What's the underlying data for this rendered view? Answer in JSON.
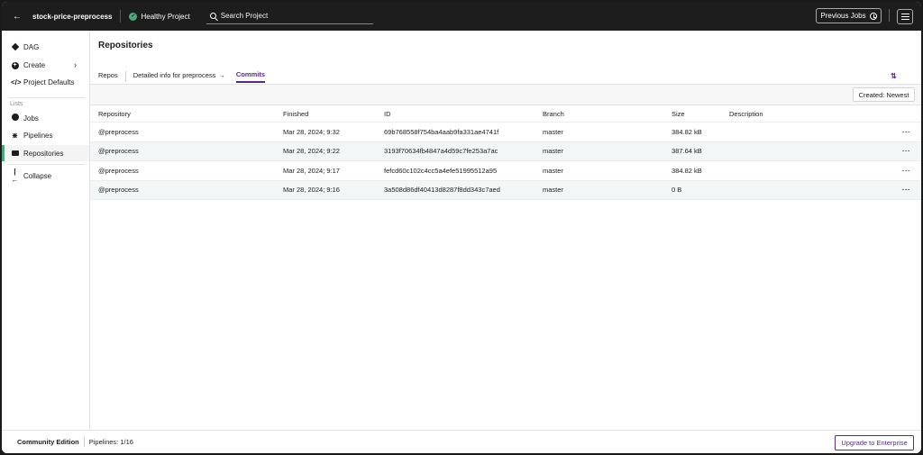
{
  "topbar": {
    "back_icon": "arrow-left",
    "project_name": "stock-price-preprocess",
    "health_label": "Healthy Project",
    "search_placeholder": "Search Project",
    "previous_jobs_label": "Previous Jobs"
  },
  "sidebar": {
    "items": [
      {
        "label": "DAG",
        "icon": "diamond-icon"
      },
      {
        "label": "Create",
        "icon": "plus-circle-icon"
      },
      {
        "label": "Project Defaults",
        "icon": "code-icon"
      }
    ],
    "lists_label": "Lists",
    "list_items": [
      {
        "label": "Jobs",
        "icon": "jobs-icon"
      },
      {
        "label": "Pipelines",
        "icon": "pipelines-icon"
      },
      {
        "label": "Repositories",
        "icon": "folder-icon"
      }
    ],
    "collapse_label": "Collapse"
  },
  "main": {
    "title": "Repositories",
    "tabs": [
      {
        "label": "Repos"
      },
      {
        "label": "Detailed info for preprocess"
      },
      {
        "label": "Commits"
      }
    ],
    "sort_label": "Created: Newest",
    "columns": [
      "Repository",
      "Finished",
      "ID",
      "Branch",
      "Size",
      "Description"
    ],
    "rows": [
      {
        "repository": "@preprocess",
        "finished": "Mar 28, 2024; 9:32",
        "id": "69b768558f754ba4aab9fa331ae4741f",
        "branch": "master",
        "size": "384.82 kB",
        "description": ""
      },
      {
        "repository": "@preprocess",
        "finished": "Mar 28, 2024; 9:22",
        "id": "3193f70634fb4847a4d59c7fe253a7ac",
        "branch": "master",
        "size": "387.64 kB",
        "description": ""
      },
      {
        "repository": "@preprocess",
        "finished": "Mar 28, 2024; 9:17",
        "id": "fefcd60c102c4cc5a4efe51995512a95",
        "branch": "master",
        "size": "384.82 kB",
        "description": ""
      },
      {
        "repository": "@preprocess",
        "finished": "Mar 28, 2024; 9:16",
        "id": "3a508d86df40413d8287f8dd343c7aed",
        "branch": "master",
        "size": "0 B",
        "description": ""
      }
    ]
  },
  "footer": {
    "edition": "Community Edition",
    "pipelines": "Pipelines: 1/16",
    "upgrade_label": "Upgrade to Enterprise"
  },
  "colors": {
    "accent": "#5b2a86",
    "healthy": "#4aa97a",
    "topbar": "#1d1d1d"
  }
}
